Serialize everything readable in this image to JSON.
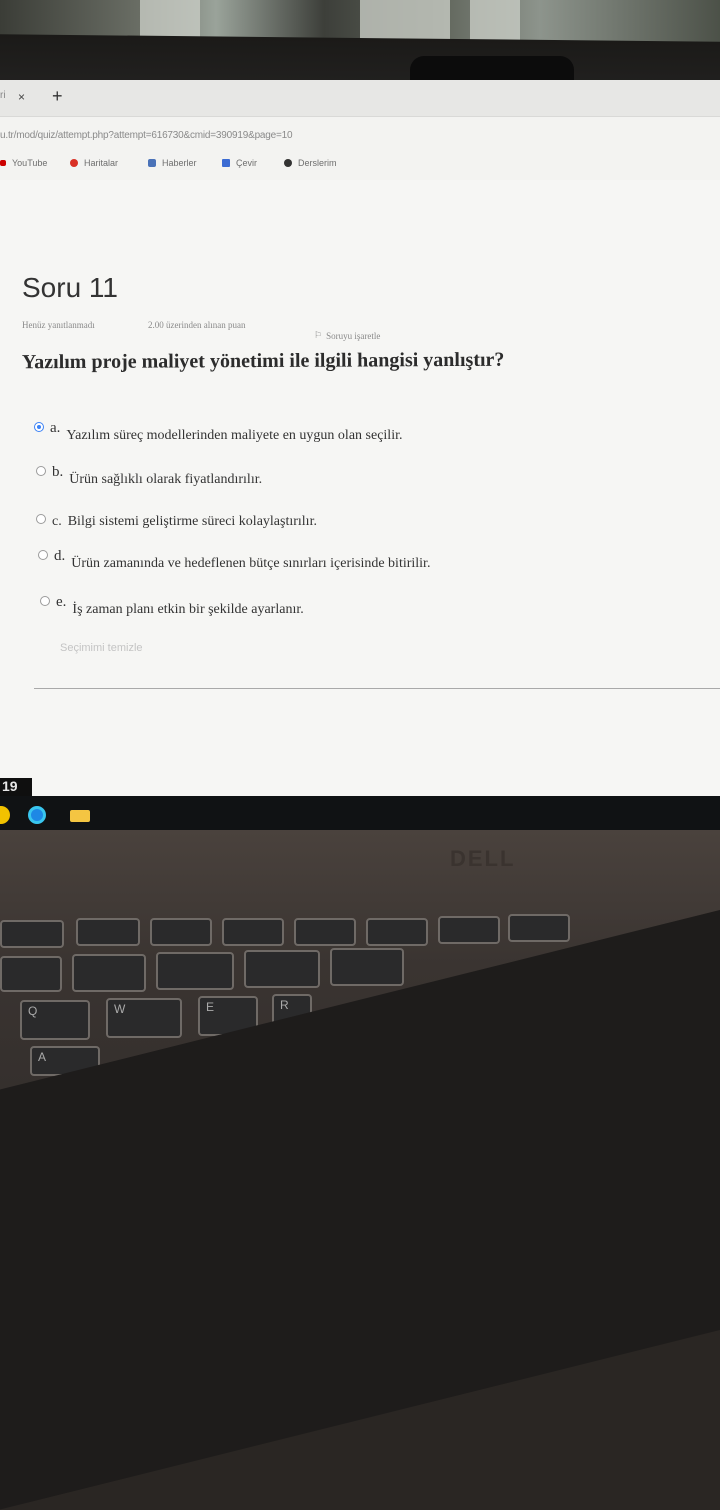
{
  "browser": {
    "tab_close_symbol": "×",
    "new_tab_symbol": "+",
    "tab_fragment": "ri",
    "address": "u.tr/mod/quiz/attempt.php?attempt=616730&cmid=390919&page=10",
    "bookmarks": [
      {
        "label": "YouTube",
        "icon": "youtube-icon",
        "color": "#cc0000"
      },
      {
        "label": "Haritalar",
        "icon": "maps-pin-icon",
        "color": "#d93025"
      },
      {
        "label": "Haberler",
        "icon": "news-icon",
        "color": "#4a72b8"
      },
      {
        "label": "Çevir",
        "icon": "translate-icon",
        "color": "#3b6bd3"
      },
      {
        "label": "Derslerim",
        "icon": "globe-icon",
        "color": "#333333"
      }
    ]
  },
  "quiz": {
    "question_title": "Soru 11",
    "status": "Henüz yanıtlanmadı",
    "points": "2.00 üzerinden alınan puan",
    "flag_label": "Soruyu işaretle",
    "question_text": "Yazılım proje maliyet yönetimi ile ilgili hangisi yanlıştır?",
    "options": [
      {
        "letter": "a.",
        "text": "Yazılım süreç modellerinden maliyete en uygun olan seçilir.",
        "selected": true
      },
      {
        "letter": "b.",
        "text": "Ürün sağlıklı olarak fiyatlandırılır.",
        "selected": false
      },
      {
        "letter": "c.",
        "text": "Bilgi sistemi geliştirme süreci kolaylaştırılır.",
        "selected": false
      },
      {
        "letter": "d.",
        "text": "Ürün zamanında ve hedeflenen bütçe sınırları içerisinde bitirilir.",
        "selected": false
      },
      {
        "letter": "e.",
        "text": "İş zaman planı etkin bir şekilde ayarlanır.",
        "selected": false
      }
    ],
    "clear_choice": "Seçimimi temizle"
  },
  "taskbar": {
    "clock": "19",
    "icons": [
      "chrome-icon",
      "edge-icon",
      "file-explorer-icon"
    ]
  },
  "laptop": {
    "brand": "DELL",
    "keys": [
      "Q",
      "W",
      "E",
      "R",
      "A"
    ]
  },
  "colors": {
    "accent": "#3b82f6",
    "screen_bg": "#f6f6f4"
  }
}
